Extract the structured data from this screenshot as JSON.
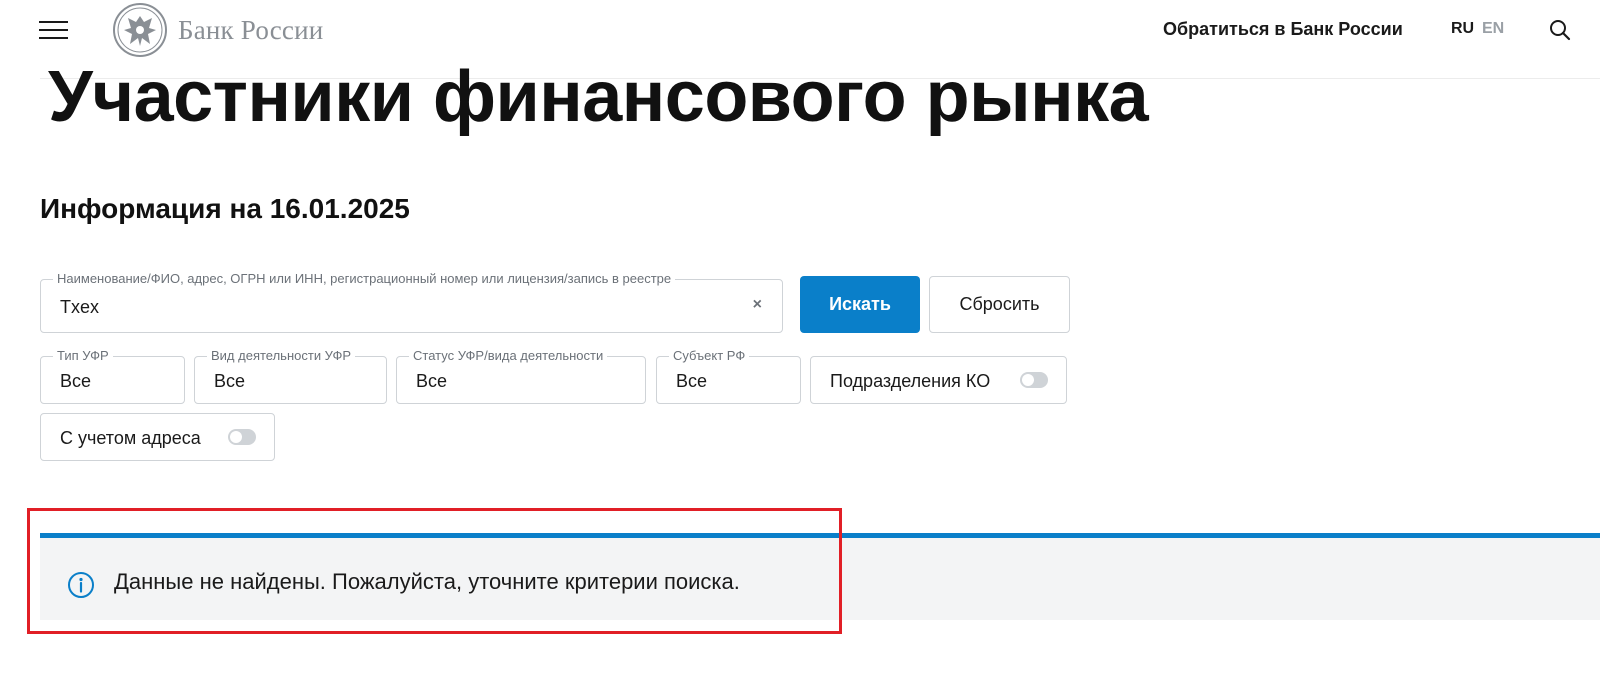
{
  "header": {
    "logo_text": "Банк России",
    "contact_link": "Обратиться в Банк России",
    "lang_ru": "RU",
    "lang_en": "EN"
  },
  "page": {
    "title": "Участники финансового рынка",
    "info_date": "Информация на 16.01.2025"
  },
  "search": {
    "label": "Наименование/ФИО, адрес, ОГРН или ИНН, регистрационный номер или лицензия/запись в реестре",
    "value": "Txex",
    "clear_symbol": "×",
    "search_button": "Искать",
    "reset_button": "Сбросить"
  },
  "filters": [
    {
      "label": "Тип УФР",
      "value": "Все"
    },
    {
      "label": "Вид деятельности УФР",
      "value": "Все"
    },
    {
      "label": "Статус УФР/вида деятельности",
      "value": "Все"
    },
    {
      "label": "Субъект РФ",
      "value": "Все"
    }
  ],
  "toggles": {
    "branches": {
      "label": "Подразделения КО",
      "on": false
    },
    "with_address": {
      "label": "С учетом адреса",
      "on": false
    }
  },
  "alert": {
    "text": "Данные не найдены. Пожалуйста, уточните критерии поиска.",
    "icon": "info-icon"
  },
  "colors": {
    "accent": "#0a7fc9",
    "highlight": "#e11f26",
    "alert_bg": "#f3f4f5"
  }
}
